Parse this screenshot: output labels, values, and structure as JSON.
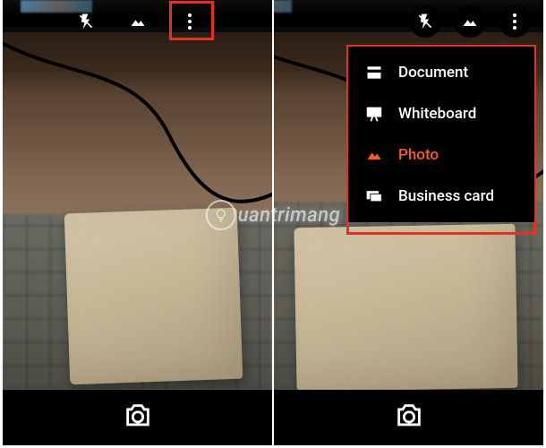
{
  "watermark": "uantrimang",
  "left": {
    "topbar": {
      "flash": "flash-off-icon",
      "mode": "image-mode-icon",
      "more": "more-icon",
      "highlighted": "mode"
    }
  },
  "right": {
    "topbar": {
      "flash": "flash-off-icon",
      "mode": "image-mode-icon",
      "more": "more-icon"
    },
    "menu": {
      "items": [
        {
          "id": "document",
          "label": "Document",
          "icon": "document-icon",
          "selected": false
        },
        {
          "id": "whiteboard",
          "label": "Whiteboard",
          "icon": "whiteboard-icon",
          "selected": false
        },
        {
          "id": "photo",
          "label": "Photo",
          "icon": "photo-icon",
          "selected": true
        },
        {
          "id": "business-card",
          "label": "Business card",
          "icon": "business-card-icon",
          "selected": false
        }
      ]
    }
  },
  "colors": {
    "highlight": "#e53122",
    "accent": "#ff5a1f"
  }
}
